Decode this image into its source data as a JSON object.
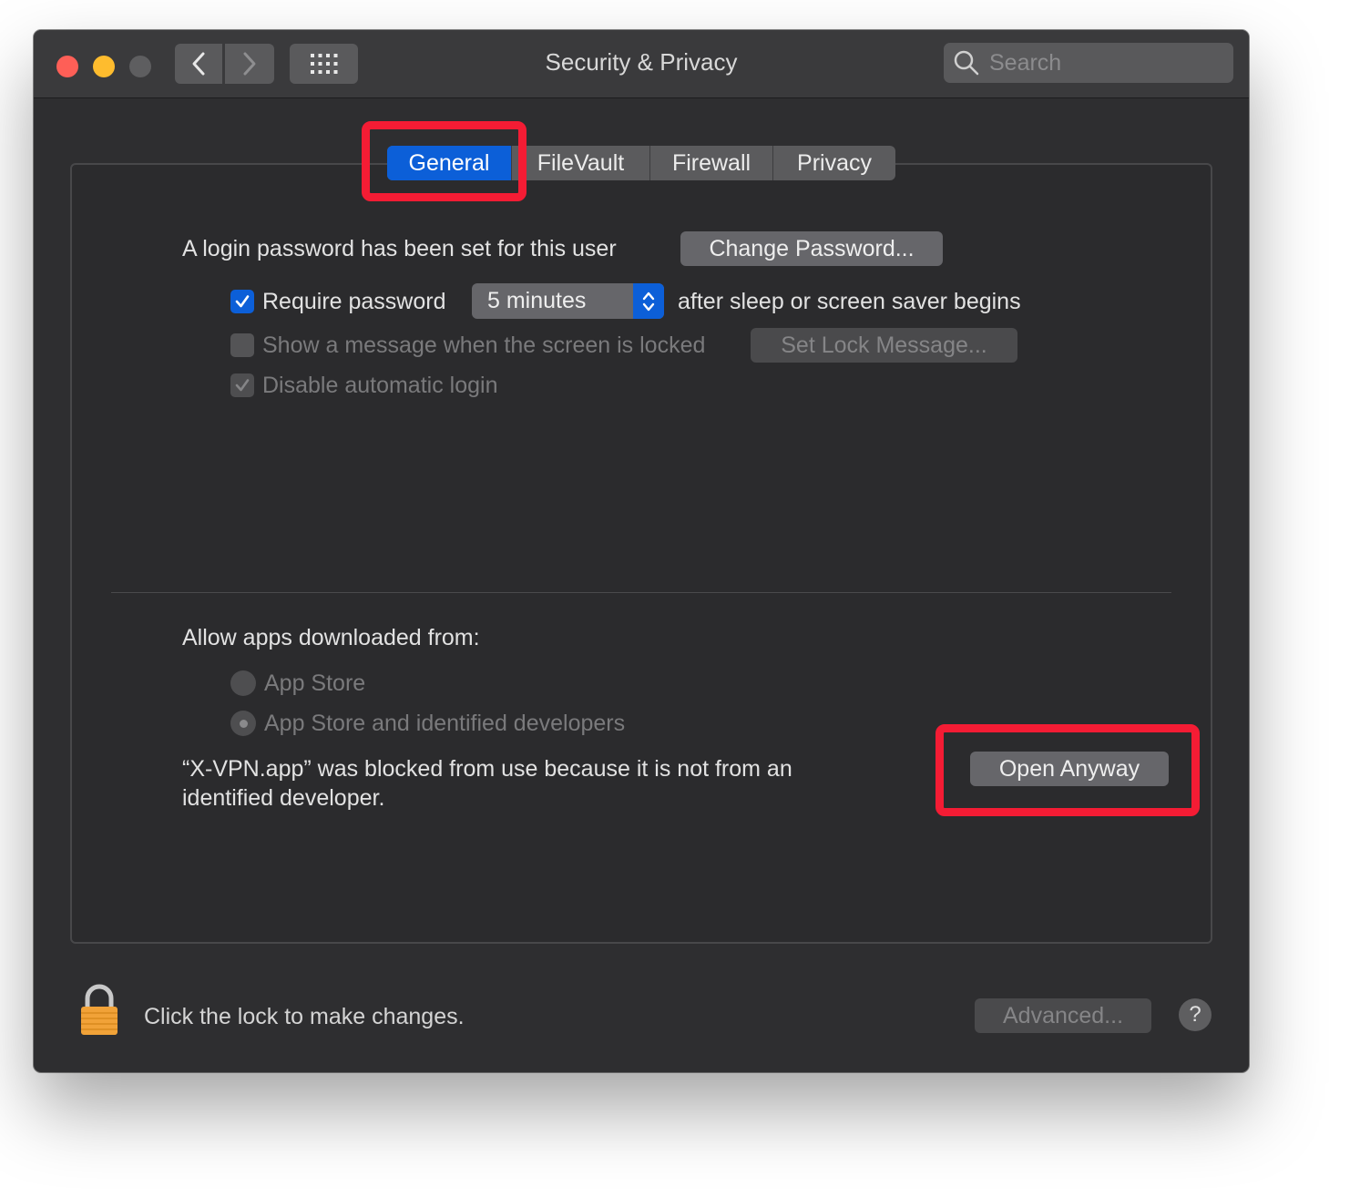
{
  "window": {
    "title": "Security & Privacy",
    "search_placeholder": "Search"
  },
  "tabs": [
    {
      "label": "General",
      "active": true
    },
    {
      "label": "FileVault",
      "active": false
    },
    {
      "label": "Firewall",
      "active": false
    },
    {
      "label": "Privacy",
      "active": false
    }
  ],
  "general": {
    "login_password_label": "A login password has been set for this user",
    "change_password_button": "Change Password...",
    "require_password": {
      "label": "Require password",
      "checked": true
    },
    "require_password_delay": "5 minutes",
    "after_sleep_label": "after sleep or screen saver begins",
    "show_message": {
      "label": "Show a message when the screen is locked",
      "checked": false,
      "enabled": false
    },
    "set_lock_message_button": "Set Lock Message...",
    "disable_auto_login": {
      "label": "Disable automatic login",
      "checked": true,
      "enabled": false
    },
    "allow_apps_heading": "Allow apps downloaded from:",
    "allow_options": [
      {
        "label": "App Store",
        "selected": false
      },
      {
        "label": "App Store and identified developers",
        "selected": true
      }
    ],
    "blocked_message": "“X-VPN.app” was blocked from use because it is not from an identified developer.",
    "open_anyway_button": "Open Anyway"
  },
  "footer": {
    "lock_text": "Click the lock to make changes.",
    "advanced_button": "Advanced...",
    "help_label": "?"
  },
  "colors": {
    "accent": "#0c5fd8",
    "highlight": "#f41c34",
    "window_bg": "#2e2e30"
  }
}
